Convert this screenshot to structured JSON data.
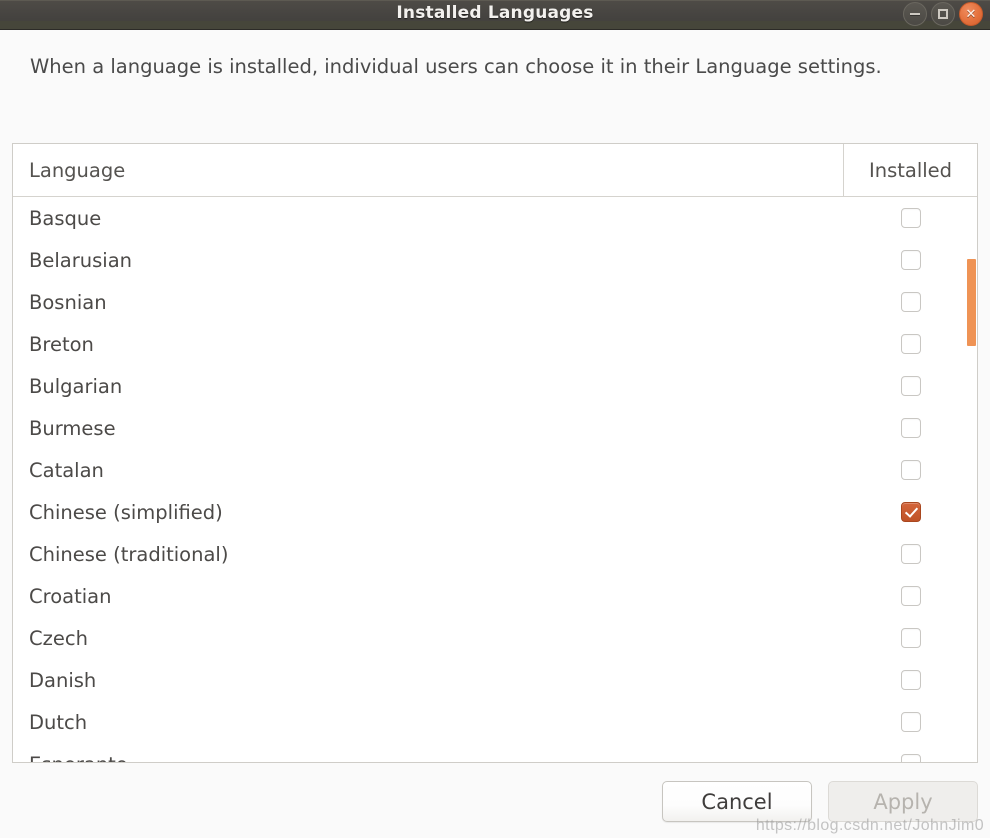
{
  "window": {
    "title": "Installed Languages",
    "controls": [
      {
        "name": "minimize-button",
        "icon": "minimize-icon",
        "label": "–"
      },
      {
        "name": "maximize-button",
        "icon": "maximize-icon",
        "label": "□"
      },
      {
        "name": "close-button",
        "icon": "close-icon",
        "label": "×"
      }
    ],
    "close_color": "#e4713d",
    "titlebar_color": "#454340"
  },
  "description": "When a language is installed, individual users can choose it in their Language settings.",
  "table": {
    "columns": [
      "Language",
      "Installed"
    ],
    "rows": [
      {
        "language": "Basque",
        "installed": false
      },
      {
        "language": "Belarusian",
        "installed": false
      },
      {
        "language": "Bosnian",
        "installed": false
      },
      {
        "language": "Breton",
        "installed": false
      },
      {
        "language": "Bulgarian",
        "installed": false
      },
      {
        "language": "Burmese",
        "installed": false
      },
      {
        "language": "Catalan",
        "installed": false
      },
      {
        "language": "Chinese (simplified)",
        "installed": true
      },
      {
        "language": "Chinese (traditional)",
        "installed": false
      },
      {
        "language": "Croatian",
        "installed": false
      },
      {
        "language": "Czech",
        "installed": false
      },
      {
        "language": "Danish",
        "installed": false
      },
      {
        "language": "Dutch",
        "installed": false
      },
      {
        "language": "Esperanto",
        "installed": false
      }
    ]
  },
  "scrollbar": {
    "thumb_color": "#ef9355"
  },
  "footer": {
    "cancel_label": "Cancel",
    "apply_label": "Apply",
    "apply_enabled": false
  },
  "watermark": "https://blog.csdn.net/JohnJim0",
  "accent_color": "#d4663c"
}
